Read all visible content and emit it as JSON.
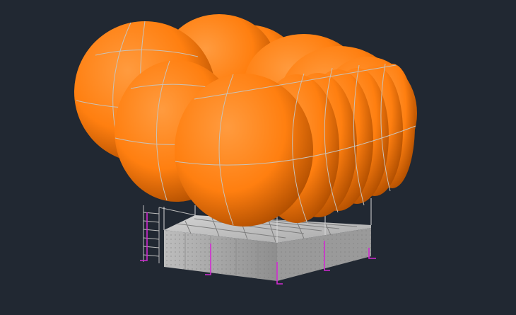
{
  "viewport": {
    "background": "#212832"
  },
  "colors": {
    "balloon_fill": "#ff7f10",
    "balloon_shade": "#b04e00",
    "balloon_highlight": "#ff9b3f",
    "wire": "#c9c2b8",
    "gondola_light": "#c6c6c6",
    "gondola_mid": "#9b9b9b",
    "gondola_dark": "#6f6f6f",
    "strut": "#d9d9d9",
    "magenta_marker": "#d12ad1"
  },
  "icons": {
    "model": "cad-3d-model-icon"
  }
}
